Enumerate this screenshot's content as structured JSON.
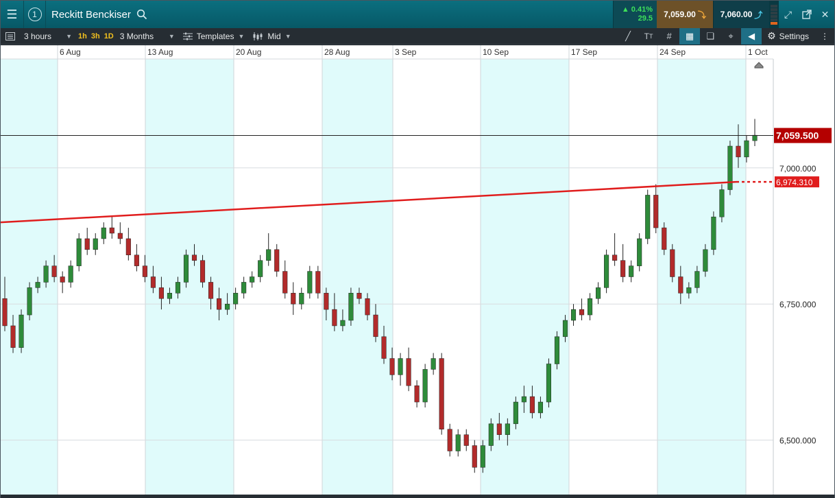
{
  "header": {
    "instrument": "Reckitt Benckiser",
    "window_number": "1",
    "change_percent": "0.41%",
    "change_points": "29.5",
    "sell_price": "7,059.00",
    "buy_price": "7,060.00"
  },
  "toolbar": {
    "interval": "3 hours",
    "timeframes": [
      "1h",
      "3h",
      "1D"
    ],
    "range": "3 Months",
    "templates_label": "Templates",
    "price_type": "Mid",
    "settings_label": "Settings"
  },
  "colors": {
    "header_bg": "#075866",
    "up": "#2e8b3a",
    "down": "#b22b2b",
    "trendline": "#e01d1d",
    "current_price_label": "#b40000",
    "weekend_shade": "#e0fbfb"
  },
  "chart_data": {
    "type": "candlestick",
    "x_tick_labels": [
      "6 Aug",
      "13 Aug",
      "20 Aug",
      "28 Aug",
      "3 Sep",
      "10 Sep",
      "17 Sep",
      "24 Sep",
      "1 Oct"
    ],
    "y_tick_labels": [
      "7,000.000",
      "6,750.000",
      "6,500.000"
    ],
    "y_ticks": [
      7000,
      6750,
      6500
    ],
    "ylim": [
      6400,
      7200
    ],
    "current_price": 7059.5,
    "current_price_label": "7,059.500",
    "trendline": {
      "start": 6900,
      "end": 6974.31,
      "label": "6,974.310"
    },
    "candles_ohlc_note": "3-hour candles, Aug 1 – Oct 1",
    "candles": [
      [
        6760,
        6800,
        6700,
        6710
      ],
      [
        6710,
        6730,
        6660,
        6670
      ],
      [
        6670,
        6740,
        6660,
        6730
      ],
      [
        6730,
        6790,
        6720,
        6780
      ],
      [
        6780,
        6800,
        6770,
        6790
      ],
      [
        6790,
        6830,
        6780,
        6820
      ],
      [
        6820,
        6840,
        6790,
        6800
      ],
      [
        6800,
        6810,
        6770,
        6790
      ],
      [
        6790,
        6830,
        6780,
        6820
      ],
      [
        6820,
        6880,
        6810,
        6870
      ],
      [
        6870,
        6890,
        6840,
        6850
      ],
      [
        6850,
        6880,
        6840,
        6870
      ],
      [
        6870,
        6900,
        6860,
        6890
      ],
      [
        6890,
        6910,
        6870,
        6880
      ],
      [
        6880,
        6900,
        6860,
        6870
      ],
      [
        6870,
        6890,
        6830,
        6840
      ],
      [
        6840,
        6860,
        6810,
        6820
      ],
      [
        6820,
        6840,
        6790,
        6800
      ],
      [
        6800,
        6820,
        6770,
        6780
      ],
      [
        6780,
        6800,
        6740,
        6760
      ],
      [
        6760,
        6780,
        6750,
        6770
      ],
      [
        6770,
        6800,
        6760,
        6790
      ],
      [
        6790,
        6850,
        6780,
        6840
      ],
      [
        6840,
        6860,
        6820,
        6830
      ],
      [
        6830,
        6840,
        6780,
        6790
      ],
      [
        6790,
        6800,
        6740,
        6760
      ],
      [
        6760,
        6780,
        6720,
        6740
      ],
      [
        6740,
        6770,
        6730,
        6750
      ],
      [
        6750,
        6780,
        6740,
        6770
      ],
      [
        6770,
        6800,
        6760,
        6790
      ],
      [
        6790,
        6810,
        6780,
        6800
      ],
      [
        6800,
        6840,
        6790,
        6830
      ],
      [
        6830,
        6880,
        6820,
        6850
      ],
      [
        6850,
        6860,
        6800,
        6810
      ],
      [
        6810,
        6830,
        6760,
        6770
      ],
      [
        6770,
        6790,
        6730,
        6750
      ],
      [
        6750,
        6780,
        6740,
        6770
      ],
      [
        6770,
        6820,
        6760,
        6810
      ],
      [
        6810,
        6820,
        6760,
        6770
      ],
      [
        6770,
        6780,
        6720,
        6740
      ],
      [
        6740,
        6770,
        6700,
        6710
      ],
      [
        6710,
        6740,
        6700,
        6720
      ],
      [
        6720,
        6780,
        6710,
        6770
      ],
      [
        6770,
        6780,
        6750,
        6760
      ],
      [
        6760,
        6770,
        6720,
        6730
      ],
      [
        6730,
        6750,
        6680,
        6690
      ],
      [
        6690,
        6710,
        6640,
        6650
      ],
      [
        6650,
        6670,
        6610,
        6620
      ],
      [
        6620,
        6660,
        6600,
        6650
      ],
      [
        6650,
        6670,
        6590,
        6600
      ],
      [
        6600,
        6610,
        6560,
        6570
      ],
      [
        6570,
        6640,
        6560,
        6630
      ],
      [
        6630,
        6660,
        6620,
        6650
      ],
      [
        6650,
        6660,
        6510,
        6520
      ],
      [
        6520,
        6530,
        6470,
        6480
      ],
      [
        6480,
        6520,
        6470,
        6510
      ],
      [
        6510,
        6520,
        6480,
        6490
      ],
      [
        6490,
        6500,
        6440,
        6450
      ],
      [
        6450,
        6500,
        6440,
        6490
      ],
      [
        6490,
        6540,
        6480,
        6530
      ],
      [
        6530,
        6550,
        6500,
        6510
      ],
      [
        6510,
        6540,
        6490,
        6530
      ],
      [
        6530,
        6580,
        6520,
        6570
      ],
      [
        6570,
        6600,
        6550,
        6580
      ],
      [
        6580,
        6600,
        6540,
        6550
      ],
      [
        6550,
        6580,
        6540,
        6570
      ],
      [
        6570,
        6650,
        6560,
        6640
      ],
      [
        6640,
        6700,
        6630,
        6690
      ],
      [
        6690,
        6730,
        6680,
        6720
      ],
      [
        6720,
        6750,
        6710,
        6740
      ],
      [
        6740,
        6760,
        6720,
        6730
      ],
      [
        6730,
        6770,
        6720,
        6760
      ],
      [
        6760,
        6790,
        6750,
        6780
      ],
      [
        6780,
        6850,
        6770,
        6840
      ],
      [
        6840,
        6880,
        6820,
        6830
      ],
      [
        6830,
        6860,
        6790,
        6800
      ],
      [
        6800,
        6830,
        6790,
        6820
      ],
      [
        6820,
        6880,
        6810,
        6870
      ],
      [
        6870,
        6960,
        6860,
        6950
      ],
      [
        6950,
        6970,
        6880,
        6890
      ],
      [
        6890,
        6900,
        6840,
        6850
      ],
      [
        6850,
        6860,
        6790,
        6800
      ],
      [
        6800,
        6820,
        6750,
        6770
      ],
      [
        6770,
        6790,
        6760,
        6780
      ],
      [
        6780,
        6820,
        6770,
        6810
      ],
      [
        6810,
        6860,
        6800,
        6850
      ],
      [
        6850,
        6920,
        6840,
        6910
      ],
      [
        6910,
        6970,
        6900,
        6960
      ],
      [
        6960,
        7050,
        6950,
        7040
      ],
      [
        7040,
        7080,
        7000,
        7020
      ],
      [
        7020,
        7060,
        7010,
        7050
      ],
      [
        7050,
        7090,
        7040,
        7060
      ]
    ]
  }
}
